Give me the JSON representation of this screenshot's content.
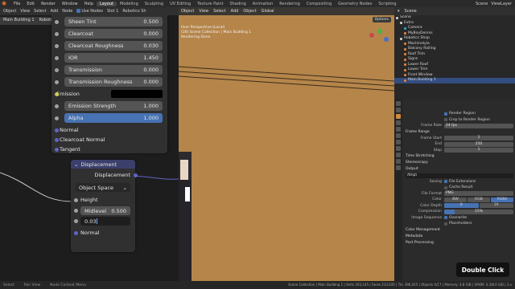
{
  "topbar": {
    "menus": [
      "File",
      "Edit",
      "Render",
      "Window",
      "Help"
    ],
    "workspaces": [
      "Layout",
      "Modeling",
      "Sculpting",
      "UV Editing",
      "Texture Paint",
      "Shading",
      "Animation",
      "Rendering",
      "Compositing",
      "Geometry Nodes",
      "Scripting"
    ],
    "active_workspace": "Layout",
    "scene": "Scene",
    "view_layer": "ViewLayer"
  },
  "node_editor": {
    "header": {
      "mode": "Object",
      "menus": [
        "View",
        "Select",
        "Add",
        "Node"
      ],
      "use_nodes": "Use Nodes",
      "slot": "Slot 1",
      "material": "Robotics Sh"
    },
    "tab": "Main Building 1",
    "breadcrumb": "Robotics Sh",
    "principled": {
      "rows": [
        {
          "label": "Sheen Tint",
          "value": "0.500",
          "kind": "field",
          "socket": "gray"
        },
        {
          "label": "Clearcoat",
          "value": "0.000",
          "kind": "field",
          "socket": "gray"
        },
        {
          "label": "Clearcoat Roughness",
          "value": "0.030",
          "kind": "field",
          "socket": "gray"
        },
        {
          "label": "IOR",
          "value": "1.450",
          "kind": "field",
          "socket": "gray"
        },
        {
          "label": "Transmission",
          "value": "0.000",
          "kind": "field",
          "socket": "gray"
        },
        {
          "label": "Transmission Roughness",
          "value": "0.000",
          "kind": "field",
          "socket": "gray"
        },
        {
          "label": "Emission",
          "value": "",
          "kind": "color",
          "socket": "yellow"
        },
        {
          "label": "Emission Strength",
          "value": "1.000",
          "kind": "field",
          "socket": "gray"
        },
        {
          "label": "Alpha",
          "value": "1.000",
          "kind": "field-blue",
          "socket": "gray"
        },
        {
          "label": "Normal",
          "value": "",
          "kind": "label",
          "socket": "purple"
        },
        {
          "label": "Clearcoat Normal",
          "value": "",
          "kind": "label",
          "socket": "purple"
        },
        {
          "label": "Tangent",
          "value": "",
          "kind": "label",
          "socket": "purple"
        }
      ]
    },
    "displacement": {
      "title": "Displacement",
      "output": "Displacement",
      "space": "Object Space",
      "height_label": "Height",
      "midlevel_label": "Midlevel",
      "midlevel_value": "0.500",
      "scale_edit_value": "0.03",
      "normal_label": "Normal"
    },
    "footer": [
      "Select",
      "Pan View",
      "Node Context Menu"
    ]
  },
  "viewport": {
    "header": {
      "mode": "Object",
      "menus": [
        "View",
        "Select",
        "Add",
        "Object"
      ],
      "orientation": "Global"
    },
    "options_label": "Options",
    "info_lines": [
      "User Perspective (Local)",
      "(30) Scene Collection | Main Building 1",
      "Rendering Done"
    ]
  },
  "outliner": {
    "search_placeholder": "",
    "items": [
      {
        "label": "Scene",
        "depth": 0,
        "color": "#cccccc",
        "selected": false
      },
      {
        "label": "Extra",
        "depth": 1,
        "color": "#cccccc",
        "selected": false
      },
      {
        "label": "Camera",
        "depth": 2,
        "color": "#2f9fcf",
        "selected": false
      },
      {
        "label": "MyBoyDennis",
        "depth": 2,
        "color": "#e0803a",
        "selected": false
      },
      {
        "label": "Robotics Shop",
        "depth": 1,
        "color": "#cccccc",
        "selected": false
      },
      {
        "label": "Machinelyia",
        "depth": 2,
        "color": "#e0803a",
        "selected": false
      },
      {
        "label": "Balcony Railing",
        "depth": 2,
        "color": "#e0803a",
        "selected": false
      },
      {
        "label": "Roof Trim",
        "depth": 2,
        "color": "#e0803a",
        "selected": false
      },
      {
        "label": "Signs",
        "depth": 2,
        "color": "#e0803a",
        "selected": false
      },
      {
        "label": "Lower Roof",
        "depth": 2,
        "color": "#e0803a",
        "selected": false
      },
      {
        "label": "Lower Trim",
        "depth": 2,
        "color": "#e0803a",
        "selected": false
      },
      {
        "label": "Front Window",
        "depth": 2,
        "color": "#e0803a",
        "selected": false
      },
      {
        "label": "Main Building 1",
        "depth": 2,
        "color": "#e0803a",
        "selected": true
      }
    ]
  },
  "properties": {
    "render_region": "Render Region",
    "crop_region": "Crop to Render Region",
    "frame_rate_label": "Frame Rate",
    "frame_rate_value": "24 fps",
    "frame_range_section": "Frame Range",
    "frame_start_label": "Frame Start",
    "frame_start_value": "1",
    "end_label": "End",
    "end_value": "250",
    "step_label": "Step",
    "step_value": "1",
    "time_stretching": "Time Stretching",
    "stereoscopy": "Stereoscopy",
    "output_section": "Output",
    "output_path": "/tmp\\",
    "saving_label": "Saving",
    "file_extensions": "File Extensions",
    "cache_result": "Cache Result",
    "file_format_label": "File Format",
    "file_format_value": "PNG",
    "color_label": "Color",
    "color_options": [
      "BW",
      "RGB",
      "RGBA"
    ],
    "color_active": "RGBA",
    "color_depth_label": "Color Depth",
    "color_depth_options": [
      "8",
      "16"
    ],
    "color_depth_active": "8",
    "compression_label": "Compression",
    "compression_value": "15%",
    "image_sequence_label": "Image Sequence",
    "overwrite": "Overwrite",
    "placeholders": "Placeholders",
    "color_management": "Color Management",
    "metadata": "Metadata",
    "post_processing": "Post Processing"
  },
  "overlay": {
    "double_click": "Double Click"
  },
  "statusbar": {
    "text": "Scene Collection | Main Building 1 | Verts 203,145 | Faces 213,635 | Tris 396,025 | Objects 0/17 | Memory: 4.8 GiB | VRAM: 4.3/8.0 GiB | 3.x"
  }
}
